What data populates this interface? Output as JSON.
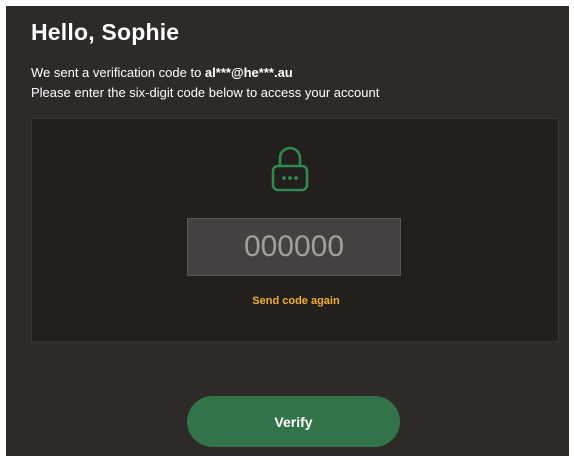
{
  "header": {
    "title": "Hello, Sophie"
  },
  "message": {
    "line1_prefix": "We sent a verification code to ",
    "masked_email": "al***@he***.au",
    "line2": "Please enter the six-digit code below to access your account"
  },
  "code_entry": {
    "icon": "lock-icon",
    "placeholder": "000000",
    "value": "",
    "resend_label": "Send code again"
  },
  "actions": {
    "verify_label": "Verify"
  },
  "colors": {
    "panel_bg": "#2d2a28",
    "box_bg": "#221f1d",
    "accent_green": "#32734a",
    "lock_green": "#2f8a50",
    "link_gold": "#f0b02a"
  }
}
